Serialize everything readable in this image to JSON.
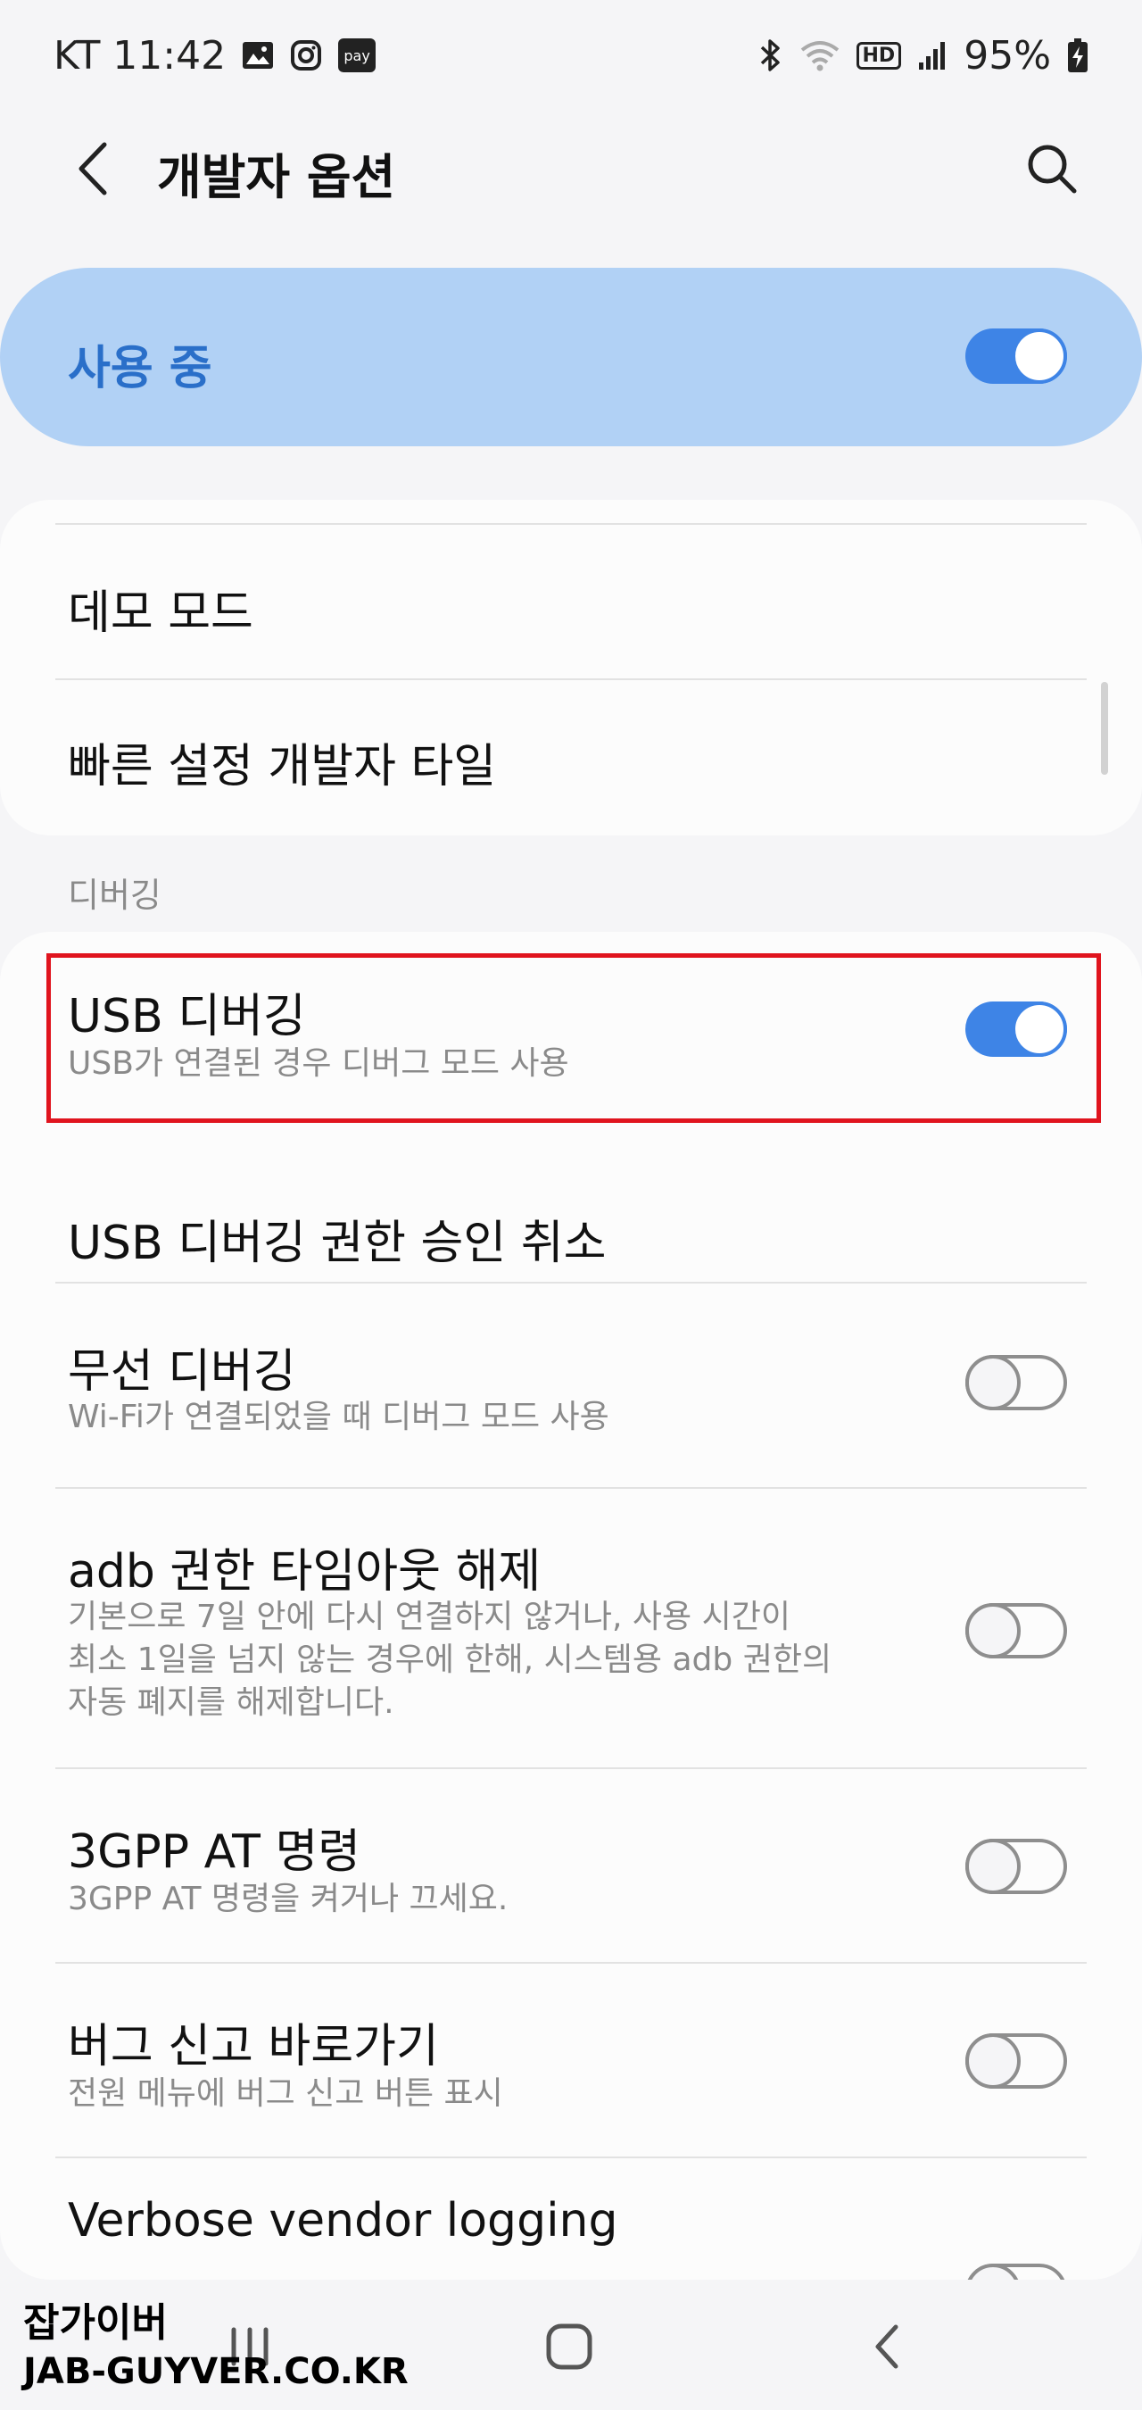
{
  "status_bar": {
    "carrier_time": "KT 11:42",
    "battery": "95%",
    "icons": [
      "gallery-icon",
      "instagram-icon",
      "pay-icon",
      "bluetooth-icon",
      "wifi-icon",
      "hd-icon",
      "signal-icon",
      "battery-charging-icon"
    ],
    "pay_label": "pay",
    "hd_label": "HD"
  },
  "app_bar": {
    "title": "개발자 옵션"
  },
  "master_switch": {
    "label": "사용 중",
    "on": true
  },
  "card_top": {
    "items": [
      {
        "title": "데모 모드"
      },
      {
        "title": "빠른 설정 개발자 타일"
      }
    ]
  },
  "section_debugging": {
    "header": "디버깅",
    "items": [
      {
        "title": "USB 디버깅",
        "subtitle": "USB가 연결된 경우 디버그 모드 사용",
        "toggle": "on"
      },
      {
        "title": "USB 디버깅 권한 승인 취소"
      },
      {
        "title": "무선 디버깅",
        "subtitle": "Wi-Fi가 연결되었을 때 디버그 모드 사용",
        "toggle": "off"
      },
      {
        "title": "adb 권한 타임아웃 해제",
        "subtitle_lines": [
          "기본으로 7일 안에 다시 연결하지 않거나, 사용 시간이",
          "최소 1일을 넘지 않는 경우에 한해, 시스템용 adb 권한의",
          "자동 폐지를 해제합니다."
        ],
        "toggle": "off"
      },
      {
        "title": "3GPP AT 명령",
        "subtitle": "3GPP AT 명령을 켜거나 끄세요.",
        "toggle": "off"
      },
      {
        "title": "버그 신고 바로가기",
        "subtitle": "전원 메뉴에 버그 신고 버튼 표시",
        "toggle": "off"
      },
      {
        "title": "Verbose vendor logging",
        "toggle": "off"
      }
    ]
  },
  "colors": {
    "accent": "#3e84e6",
    "master_bg": "#b1d1f5",
    "highlight": "#e0141e"
  },
  "watermark": {
    "line1": "잡가이버",
    "line2": "JAB-GUYVER.CO.KR"
  }
}
